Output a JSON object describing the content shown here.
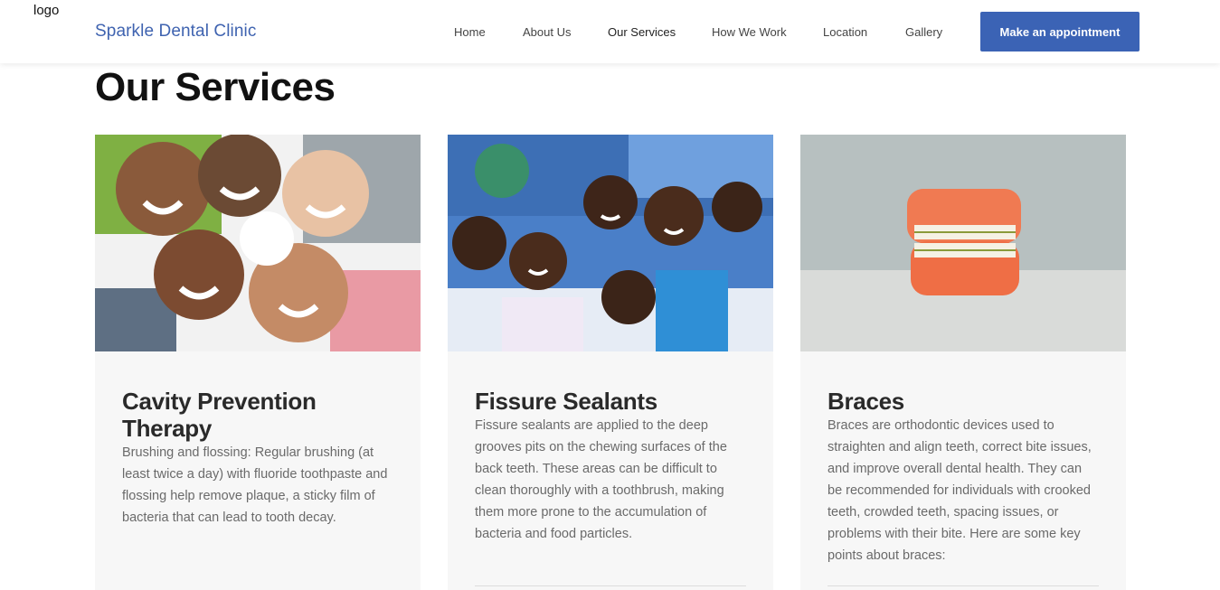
{
  "header": {
    "logo_text": "logo",
    "brand": "Sparkle Dental Clinic",
    "nav": [
      "Home",
      "About Us",
      "Our Services",
      "How We Work",
      "Location",
      "Gallery"
    ],
    "active_nav": "Our Services",
    "cta_label": "Make an appointment"
  },
  "colors": {
    "brand": "#3f63b0",
    "cta_background": "#3b63b5",
    "card_background": "#f7f7f7"
  },
  "main": {
    "title": "Our Services",
    "services": [
      {
        "title": "Cavity Prevention Therapy",
        "image": "group-of-smiling-children-photo",
        "description": "Brushing and flossing: Regular brushing (at least twice a day) with fluoride toothpaste and flossing help remove plaque, a sticky film of bacteria that can lead to tooth decay."
      },
      {
        "title": "Fissure Sealants",
        "image": "children-waving-photo",
        "description": "Fissure sealants are applied to the deep grooves pits on the chewing surfaces of the back teeth. These areas can be difficult to clean thoroughly with a toothbrush, making them more prone to the accumulation of bacteria and food particles."
      },
      {
        "title": "Braces",
        "image": "dental-braces-model-photo",
        "description": "Braces are orthodontic devices used to straighten and align teeth, correct bite issues, and improve overall dental health. They can be recommended for individuals with crooked teeth, crowded teeth, spacing issues, or problems with their bite. Here are some key points about braces:"
      }
    ]
  }
}
